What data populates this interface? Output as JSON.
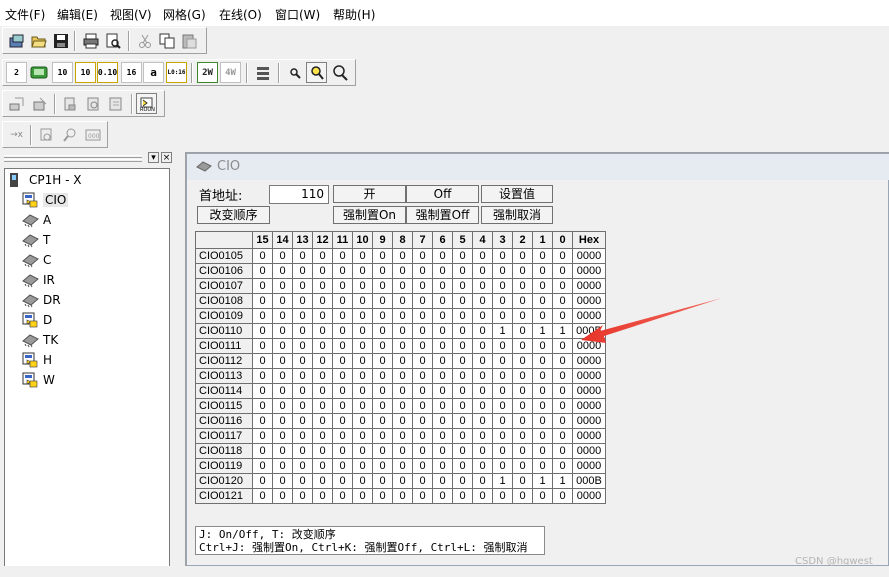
{
  "menu": [
    "文件(F)",
    "编辑(E)",
    "视图(V)",
    "网格(G)",
    "在线(O)",
    "窗口(W)",
    "帮助(H)"
  ],
  "toolbar2_text_buttons": [
    "2",
    "10",
    "10",
    "0.10",
    "16",
    "a",
    "L0:16",
    "2W",
    "4W"
  ],
  "toolbar_icons": [
    "new-project-icon",
    "open-icon",
    "save-icon",
    "print-icon",
    "print-preview-icon",
    "cut-icon",
    "copy-icon",
    "paste-icon",
    "binary-format-icon",
    "online-icon",
    "decimal-icon",
    "signed-decimal-icon",
    "bcd-icon",
    "hex-icon",
    "ascii-icon",
    "floating-icon",
    "word-2-icon",
    "word-4-icon",
    "scroll-icon",
    "zoom-out-icon",
    "zoom-icon",
    "zoom-in-icon",
    "transfer-to-icon",
    "compare-icon",
    "transfer-from-icon",
    "verify-icon",
    "memory-icon",
    "monitor-icon",
    "force-x-icon",
    "watch-icon",
    "search-icon",
    "address-icon"
  ],
  "panel_buttons": [
    "▾",
    "×"
  ],
  "tree": {
    "root": "CP1H - X",
    "items": [
      {
        "label": "CIO",
        "icon": "memory-area-active-icon",
        "selected": true
      },
      {
        "label": "A",
        "icon": "memory-chip-icon"
      },
      {
        "label": "T",
        "icon": "memory-chip-icon"
      },
      {
        "label": "C",
        "icon": "memory-chip-icon"
      },
      {
        "label": "IR",
        "icon": "memory-chip-icon"
      },
      {
        "label": "DR",
        "icon": "memory-chip-icon"
      },
      {
        "label": "D",
        "icon": "memory-area-active-icon"
      },
      {
        "label": "TK",
        "icon": "memory-chip-icon"
      },
      {
        "label": "H",
        "icon": "memory-area-active-icon"
      },
      {
        "label": "W",
        "icon": "memory-area-active-icon"
      }
    ]
  },
  "window": {
    "title": "CIO",
    "addr_label": "首地址:",
    "addr_value": "110",
    "btn_on": "开",
    "btn_off": "Off",
    "btn_set": "设置值",
    "btn_order": "改变顺序",
    "btn_force_on": "强制置On",
    "btn_force_off": "强制置Off",
    "btn_force_cancel": "强制取消"
  },
  "grid": {
    "bit_headers": [
      "15",
      "14",
      "13",
      "12",
      "11",
      "10",
      "9",
      "8",
      "7",
      "6",
      "5",
      "4",
      "3",
      "2",
      "1",
      "0"
    ],
    "hex_header": "Hex",
    "rows": [
      {
        "addr": "CIO0105",
        "bits": [
          "0",
          "0",
          "0",
          "0",
          "0",
          "0",
          "0",
          "0",
          "0",
          "0",
          "0",
          "0",
          "0",
          "0",
          "0",
          "0"
        ],
        "hex": "0000"
      },
      {
        "addr": "CIO0106",
        "bits": [
          "0",
          "0",
          "0",
          "0",
          "0",
          "0",
          "0",
          "0",
          "0",
          "0",
          "0",
          "0",
          "0",
          "0",
          "0",
          "0"
        ],
        "hex": "0000"
      },
      {
        "addr": "CIO0107",
        "bits": [
          "0",
          "0",
          "0",
          "0",
          "0",
          "0",
          "0",
          "0",
          "0",
          "0",
          "0",
          "0",
          "0",
          "0",
          "0",
          "0"
        ],
        "hex": "0000"
      },
      {
        "addr": "CIO0108",
        "bits": [
          "0",
          "0",
          "0",
          "0",
          "0",
          "0",
          "0",
          "0",
          "0",
          "0",
          "0",
          "0",
          "0",
          "0",
          "0",
          "0"
        ],
        "hex": "0000"
      },
      {
        "addr": "CIO0109",
        "bits": [
          "0",
          "0",
          "0",
          "0",
          "0",
          "0",
          "0",
          "0",
          "0",
          "0",
          "0",
          "0",
          "0",
          "0",
          "0",
          "0"
        ],
        "hex": "0000"
      },
      {
        "addr": "CIO0110",
        "bits": [
          "0",
          "0",
          "0",
          "0",
          "0",
          "0",
          "0",
          "0",
          "0",
          "0",
          "0",
          "0",
          "1",
          "0",
          "1",
          "1"
        ],
        "hex": "000B"
      },
      {
        "addr": "CIO0111",
        "bits": [
          "0",
          "0",
          "0",
          "0",
          "0",
          "0",
          "0",
          "0",
          "0",
          "0",
          "0",
          "0",
          "0",
          "0",
          "0",
          "0"
        ],
        "hex": "0000"
      },
      {
        "addr": "CIO0112",
        "bits": [
          "0",
          "0",
          "0",
          "0",
          "0",
          "0",
          "0",
          "0",
          "0",
          "0",
          "0",
          "0",
          "0",
          "0",
          "0",
          "0"
        ],
        "hex": "0000"
      },
      {
        "addr": "CIO0113",
        "bits": [
          "0",
          "0",
          "0",
          "0",
          "0",
          "0",
          "0",
          "0",
          "0",
          "0",
          "0",
          "0",
          "0",
          "0",
          "0",
          "0"
        ],
        "hex": "0000"
      },
      {
        "addr": "CIO0114",
        "bits": [
          "0",
          "0",
          "0",
          "0",
          "0",
          "0",
          "0",
          "0",
          "0",
          "0",
          "0",
          "0",
          "0",
          "0",
          "0",
          "0"
        ],
        "hex": "0000"
      },
      {
        "addr": "CIO0115",
        "bits": [
          "0",
          "0",
          "0",
          "0",
          "0",
          "0",
          "0",
          "0",
          "0",
          "0",
          "0",
          "0",
          "0",
          "0",
          "0",
          "0"
        ],
        "hex": "0000"
      },
      {
        "addr": "CIO0116",
        "bits": [
          "0",
          "0",
          "0",
          "0",
          "0",
          "0",
          "0",
          "0",
          "0",
          "0",
          "0",
          "0",
          "0",
          "0",
          "0",
          "0"
        ],
        "hex": "0000"
      },
      {
        "addr": "CIO0117",
        "bits": [
          "0",
          "0",
          "0",
          "0",
          "0",
          "0",
          "0",
          "0",
          "0",
          "0",
          "0",
          "0",
          "0",
          "0",
          "0",
          "0"
        ],
        "hex": "0000"
      },
      {
        "addr": "CIO0118",
        "bits": [
          "0",
          "0",
          "0",
          "0",
          "0",
          "0",
          "0",
          "0",
          "0",
          "0",
          "0",
          "0",
          "0",
          "0",
          "0",
          "0"
        ],
        "hex": "0000"
      },
      {
        "addr": "CIO0119",
        "bits": [
          "0",
          "0",
          "0",
          "0",
          "0",
          "0",
          "0",
          "0",
          "0",
          "0",
          "0",
          "0",
          "0",
          "0",
          "0",
          "0"
        ],
        "hex": "0000"
      },
      {
        "addr": "CIO0120",
        "bits": [
          "0",
          "0",
          "0",
          "0",
          "0",
          "0",
          "0",
          "0",
          "0",
          "0",
          "0",
          "0",
          "1",
          "0",
          "1",
          "1"
        ],
        "hex": "000B"
      },
      {
        "addr": "CIO0121",
        "bits": [
          "0",
          "0",
          "0",
          "0",
          "0",
          "0",
          "0",
          "0",
          "0",
          "0",
          "0",
          "0",
          "0",
          "0",
          "0",
          "0"
        ],
        "hex": "0000"
      }
    ]
  },
  "help": {
    "line1": "J: On/Off,   T: 改变顺序",
    "line2": "Ctrl+J: 强制置On,  Ctrl+K:  强制置Off,  Ctrl+L: 强制取消"
  },
  "annotation_arrow_color": "#e8342a",
  "watermark": "CSDN @hqwest"
}
